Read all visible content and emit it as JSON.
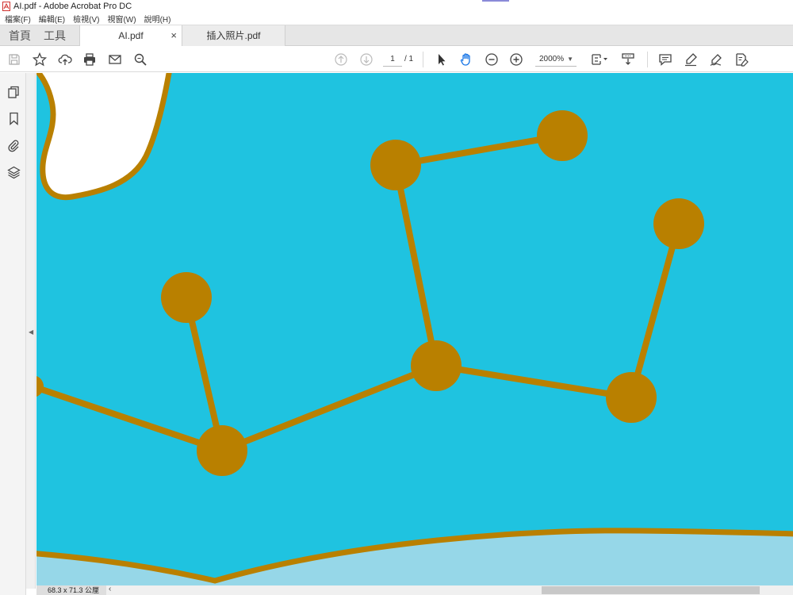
{
  "window": {
    "title": "AI.pdf - Adobe Acrobat Pro DC"
  },
  "menu": [
    "檔案(F)",
    "編輯(E)",
    "檢視(V)",
    "視窗(W)",
    "說明(H)"
  ],
  "nav": {
    "home": "首頁",
    "tools": "工具"
  },
  "tabs": [
    {
      "label": "AI.pdf",
      "close": "×"
    },
    {
      "label": "插入照片.pdf"
    }
  ],
  "toolbar": {
    "page_current": "1",
    "page_total": "/ 1",
    "zoom": "2000%"
  },
  "status": {
    "dimensions": "68.3 x 71.3 公厘"
  },
  "colors": {
    "canvas_bg": "#1fc3e0",
    "molecule": "#b98000",
    "lower_band": "#96d7e8",
    "white_blob": "#ffffff"
  },
  "icons": {
    "toolbar": [
      "save-icon",
      "bookmark-star-icon",
      "upload-cloud-icon",
      "print-icon",
      "email-icon",
      "search-icon",
      "page-up-icon",
      "page-down-icon",
      "select-cursor-icon",
      "hand-tool-icon",
      "zoom-out-icon",
      "zoom-in-icon",
      "page-fit-icon",
      "scroll-mode-icon",
      "comment-icon",
      "highlight-icon",
      "sign-icon",
      "fill-sign-icon"
    ],
    "rail": [
      "pages-icon",
      "bookmarks-icon",
      "attachments-icon",
      "layers-icon"
    ]
  }
}
